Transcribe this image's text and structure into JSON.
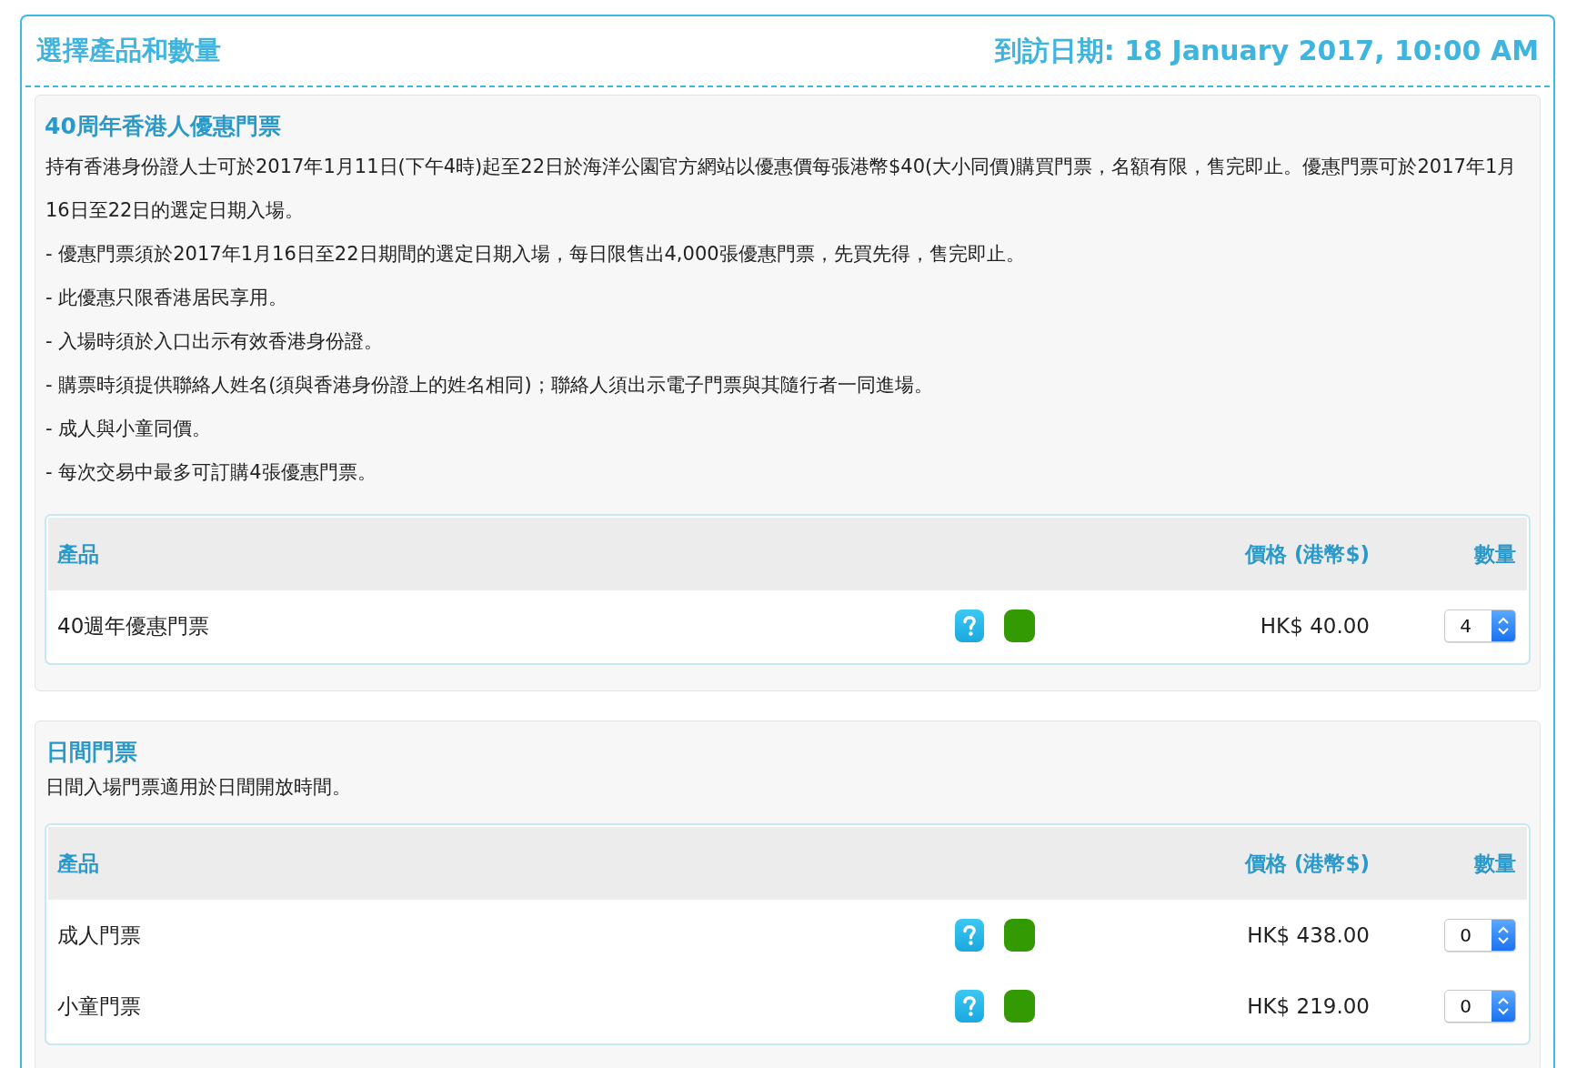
{
  "header": {
    "title": "選擇產品和數量",
    "visit_date": "到訪日期: 18 January 2017, 10:00 AM"
  },
  "sections": [
    {
      "title": "40周年香港人優惠門票",
      "paragraphs": [
        "持有香港身份證人士可於2017年1月11日(下午4時)起至22日於海洋公園官方網站以優惠價每張港幣$40(大小同價)購買門票，名額有限，售完即止。優惠門票可於2017年1月16日至22日的選定日期入場。",
        "- 優惠門票須於2017年1月16日至22日期間的選定日期入場，每日限售出4,000張優惠門票，先買先得，售完即止。",
        "- 此優惠只限香港居民享用。",
        "- 入場時須於入口出示有效香港身份證。",
        "- 購票時須提供聯絡人姓名(須與香港身份證上的姓名相同)；聯絡人須出示電子門票與其隨行者一同進場。",
        "- 成人與小童同價。",
        "- 每次交易中最多可訂購4張優惠門票。"
      ],
      "table": {
        "columns": [
          "產品",
          "價格 (港幣$)",
          "數量"
        ],
        "rows": [
          {
            "product": "40週年優惠門票",
            "price": "HK$ 40.00",
            "quantity": "4"
          }
        ]
      }
    },
    {
      "title": "日間門票",
      "paragraphs": [
        "日間入場門票適用於日間開放時間。"
      ],
      "table": {
        "columns": [
          "產品",
          "價格 (港幣$)",
          "數量"
        ],
        "rows": [
          {
            "product": "成人門票",
            "price": "HK$ 438.00",
            "quantity": "0"
          },
          {
            "product": "小童門票",
            "price": "HK$ 219.00",
            "quantity": "0"
          }
        ]
      }
    }
  ]
}
